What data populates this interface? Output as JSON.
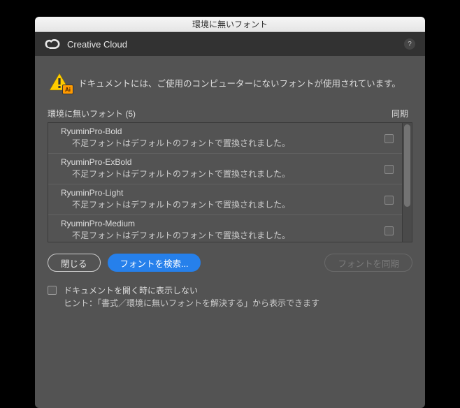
{
  "titlebar": {
    "title": "環境に無いフォント"
  },
  "cc": {
    "label": "Creative Cloud",
    "help_tooltip": "?"
  },
  "warning": {
    "text": "ドキュメントには、ご使用のコンピューターにないフォントが使用されています。",
    "ai_badge": "Ai"
  },
  "list": {
    "header_label": "環境に無いフォント (5)",
    "sync_label": "同期",
    "replaced_msg": "不足フォントはデフォルトのフォントで置換されました。",
    "items": [
      {
        "name": "RyuminPro-Bold"
      },
      {
        "name": "RyuminPro-ExBold"
      },
      {
        "name": "RyuminPro-Light"
      },
      {
        "name": "RyuminPro-Medium"
      }
    ]
  },
  "buttons": {
    "close": "閉じる",
    "search": "フォントを検索...",
    "sync": "フォントを同期"
  },
  "bottom": {
    "dont_show": "ドキュメントを開く時に表示しない",
    "hint": "ヒント：「書式／環境に無いフォントを解決する」から表示できます"
  }
}
